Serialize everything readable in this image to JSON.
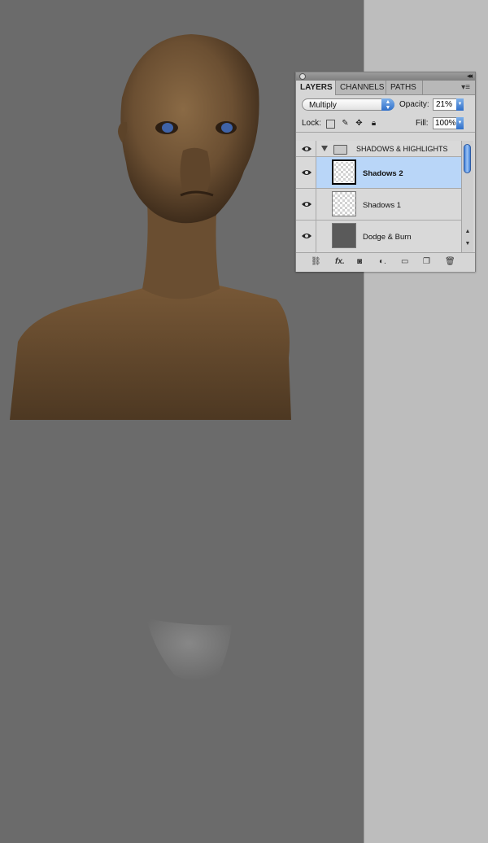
{
  "panel": {
    "tabs": [
      {
        "label": "LAYERS",
        "active": true
      },
      {
        "label": "CHANNELS",
        "active": false
      },
      {
        "label": "PATHS",
        "active": false
      }
    ],
    "blend_mode": "Multiply",
    "opacity_label": "Opacity:",
    "opacity_value": "21%",
    "lock_label": "Lock:",
    "fill_label": "Fill:",
    "fill_value": "100%",
    "group": {
      "name": "SHADOWS & HIGHLIGHTS",
      "visible": true,
      "expanded": true
    },
    "layers": [
      {
        "name": "Shadows 2",
        "selected": true,
        "visible": true
      },
      {
        "name": "Shadows 1",
        "selected": false,
        "visible": true
      },
      {
        "name": "Dodge & Burn",
        "selected": false,
        "visible": true
      }
    ],
    "footer_icons": [
      "link-icon",
      "fx-icon",
      "mask-icon",
      "adjustment-icon",
      "folder-icon",
      "new-layer-icon",
      "trash-icon"
    ],
    "accent_color": "#b9d6f8"
  }
}
